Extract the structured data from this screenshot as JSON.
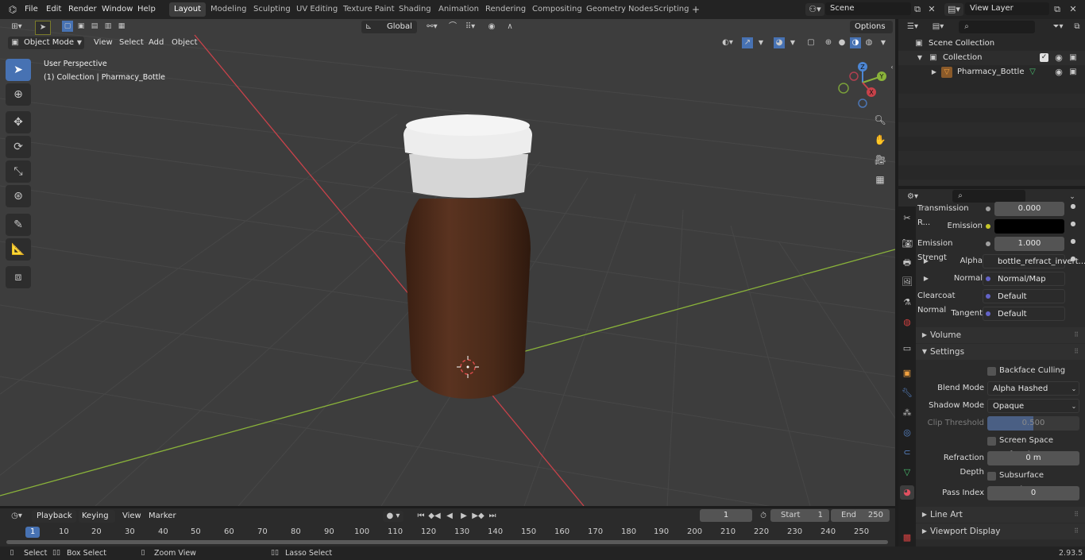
{
  "menu": {
    "items": [
      "File",
      "Edit",
      "Render",
      "Window",
      "Help"
    ],
    "workspaces": [
      "Layout",
      "Modeling",
      "Sculpting",
      "UV Editing",
      "Texture Paint",
      "Shading",
      "Animation",
      "Rendering",
      "Compositing",
      "Geometry Nodes",
      "Scripting"
    ],
    "active_workspace": "Layout",
    "scene": "Scene",
    "view_layer": "View Layer"
  },
  "viewport": {
    "mode": "Object Mode",
    "menus": [
      "View",
      "Select",
      "Add",
      "Object"
    ],
    "transform_orientation": "Global",
    "options_label": "Options",
    "overlay_title": "User Perspective",
    "overlay_subtitle": "(1) Collection | Pharmacy_Bottle",
    "gizmo": {
      "x": "X",
      "y": "Y",
      "z": "Z"
    }
  },
  "outliner": {
    "scene_collection": "Scene Collection",
    "collection": "Collection",
    "object": "Pharmacy_Bottle"
  },
  "properties": {
    "rows": [
      {
        "label": "Transmission R...",
        "value": "0.000"
      },
      {
        "label": "Emission",
        "value": ""
      },
      {
        "label": "Emission Strengt",
        "value": "1.000"
      },
      {
        "label": "Alpha",
        "value": "bottle_refract_invert..."
      },
      {
        "label": "Normal",
        "value": "Normal/Map"
      },
      {
        "label": "Clearcoat Normal",
        "value": "Default"
      },
      {
        "label": "Tangent",
        "value": "Default"
      }
    ],
    "volume_label": "Volume",
    "settings_label": "Settings",
    "backface_culling": "Backface Culling",
    "blend_mode_label": "Blend Mode",
    "blend_mode": "Alpha Hashed",
    "shadow_mode_label": "Shadow Mode",
    "shadow_mode": "Opaque",
    "clip_threshold_label": "Clip Threshold",
    "clip_threshold": "0.500",
    "screen_space_refraction": "Screen Space Refraction",
    "refraction_depth_label": "Refraction Depth",
    "refraction_depth": "0 m",
    "subsurface_translucency": "Subsurface Translucency",
    "pass_index_label": "Pass Index",
    "pass_index": "0",
    "line_art": "Line Art",
    "viewport_display": "Viewport Display"
  },
  "timeline": {
    "menus": [
      "Playback",
      "Keying",
      "View",
      "Marker"
    ],
    "current_frame": "1",
    "start_label": "Start",
    "start": "1",
    "end_label": "End",
    "end": "250",
    "ticks": [
      "1",
      "10",
      "20",
      "30",
      "40",
      "50",
      "60",
      "70",
      "80",
      "90",
      "100",
      "110",
      "120",
      "130",
      "140",
      "150",
      "160",
      "170",
      "180",
      "190",
      "200",
      "210",
      "220",
      "230",
      "240",
      "250"
    ]
  },
  "status": {
    "select": "Select",
    "box_select": "Box Select",
    "zoom_view": "Zoom View",
    "lasso_select": "Lasso Select",
    "version": "2.93.5"
  },
  "colors": {
    "accent": "#4772b3",
    "x_axis": "#c8424a",
    "y_axis": "#8ab33a",
    "bottle": "#4a2a1a",
    "cap": "#e8e8e8"
  }
}
